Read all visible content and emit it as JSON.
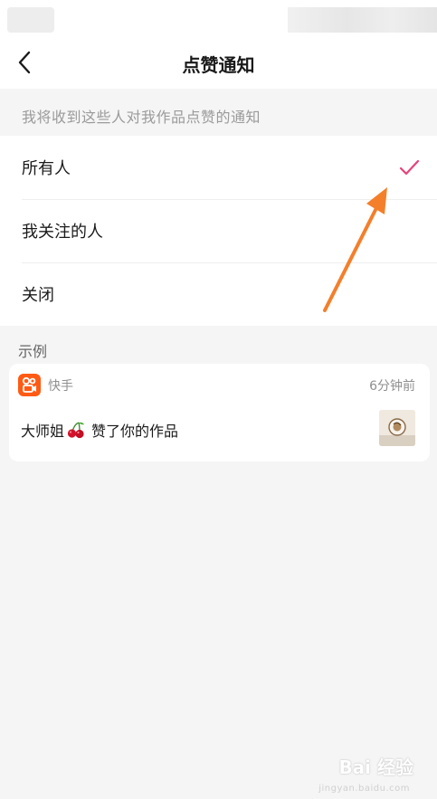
{
  "header": {
    "title": "点赞通知",
    "back_icon": "chevron-left-icon"
  },
  "settings": {
    "description": "我将收到这些人对我作品点赞的通知",
    "options": [
      {
        "label": "所有人",
        "selected": true
      },
      {
        "label": "我关注的人",
        "selected": false
      },
      {
        "label": "关闭",
        "selected": false
      }
    ],
    "check_icon": "checkmark-icon",
    "accent_color": "#e8417a"
  },
  "example": {
    "label": "示例",
    "notification": {
      "app_name": "快手",
      "app_icon_color": "#ff5a14",
      "time": "6分钟前",
      "user_name": "大师姐",
      "emoji": "cherry",
      "action": "赞了你的作品"
    }
  },
  "annotation": {
    "arrow_color": "#f47f2b"
  },
  "watermark": {
    "text": "Bai 经验",
    "sub": "jingyan.baidu.com"
  }
}
